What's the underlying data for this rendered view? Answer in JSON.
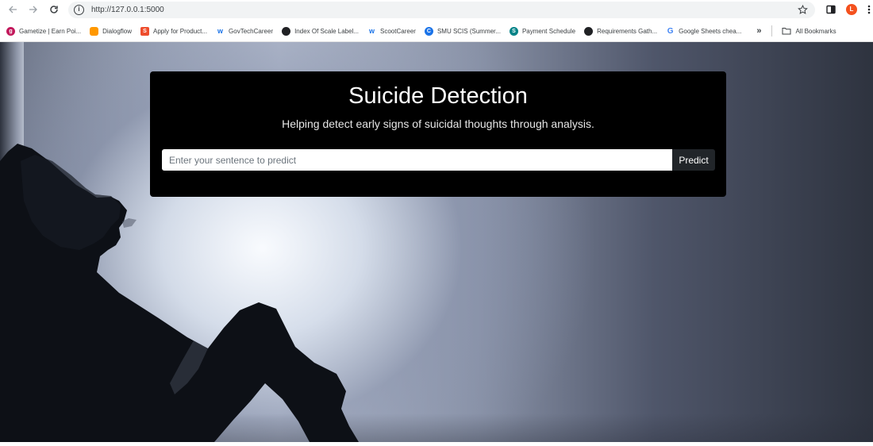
{
  "browser": {
    "url": "http://127.0.0.1:5000",
    "profile_initial": "L",
    "bookmarks": [
      {
        "label": "Gametize | Earn Poi...",
        "icon": "gametize-icon",
        "color": "#c2185b"
      },
      {
        "label": "Dialogflow",
        "icon": "dialogflow-icon",
        "color": "#ff9800"
      },
      {
        "label": "Apply for Product...",
        "icon": "shopee-icon",
        "color": "#ee4d2d"
      },
      {
        "label": "GovTechCareer",
        "icon": "workday-icon",
        "color": "#f5a623"
      },
      {
        "label": "Index Of Scale Label...",
        "icon": "globe-icon",
        "color": "#202124"
      },
      {
        "label": "ScootCareer",
        "icon": "workday-icon",
        "color": "#f5a623"
      },
      {
        "label": "SMU SCIS (Summer...",
        "icon": "smu-icon",
        "color": "#1a73e8"
      },
      {
        "label": "Payment Schedule",
        "icon": "sharepoint-icon",
        "color": "#038387"
      },
      {
        "label": "Requirements Gath...",
        "icon": "globe-icon",
        "color": "#202124"
      },
      {
        "label": "Google Sheets chea...",
        "icon": "google-icon",
        "color": "#4285f4"
      }
    ],
    "overflow_label": "»",
    "all_bookmarks_label": "All Bookmarks"
  },
  "page": {
    "title": "Suicide Detection",
    "subtitle": "Helping detect early signs of suicidal thoughts through analysis.",
    "input_placeholder": "Enter your sentence to predict",
    "input_value": "",
    "predict_label": "Predict"
  }
}
